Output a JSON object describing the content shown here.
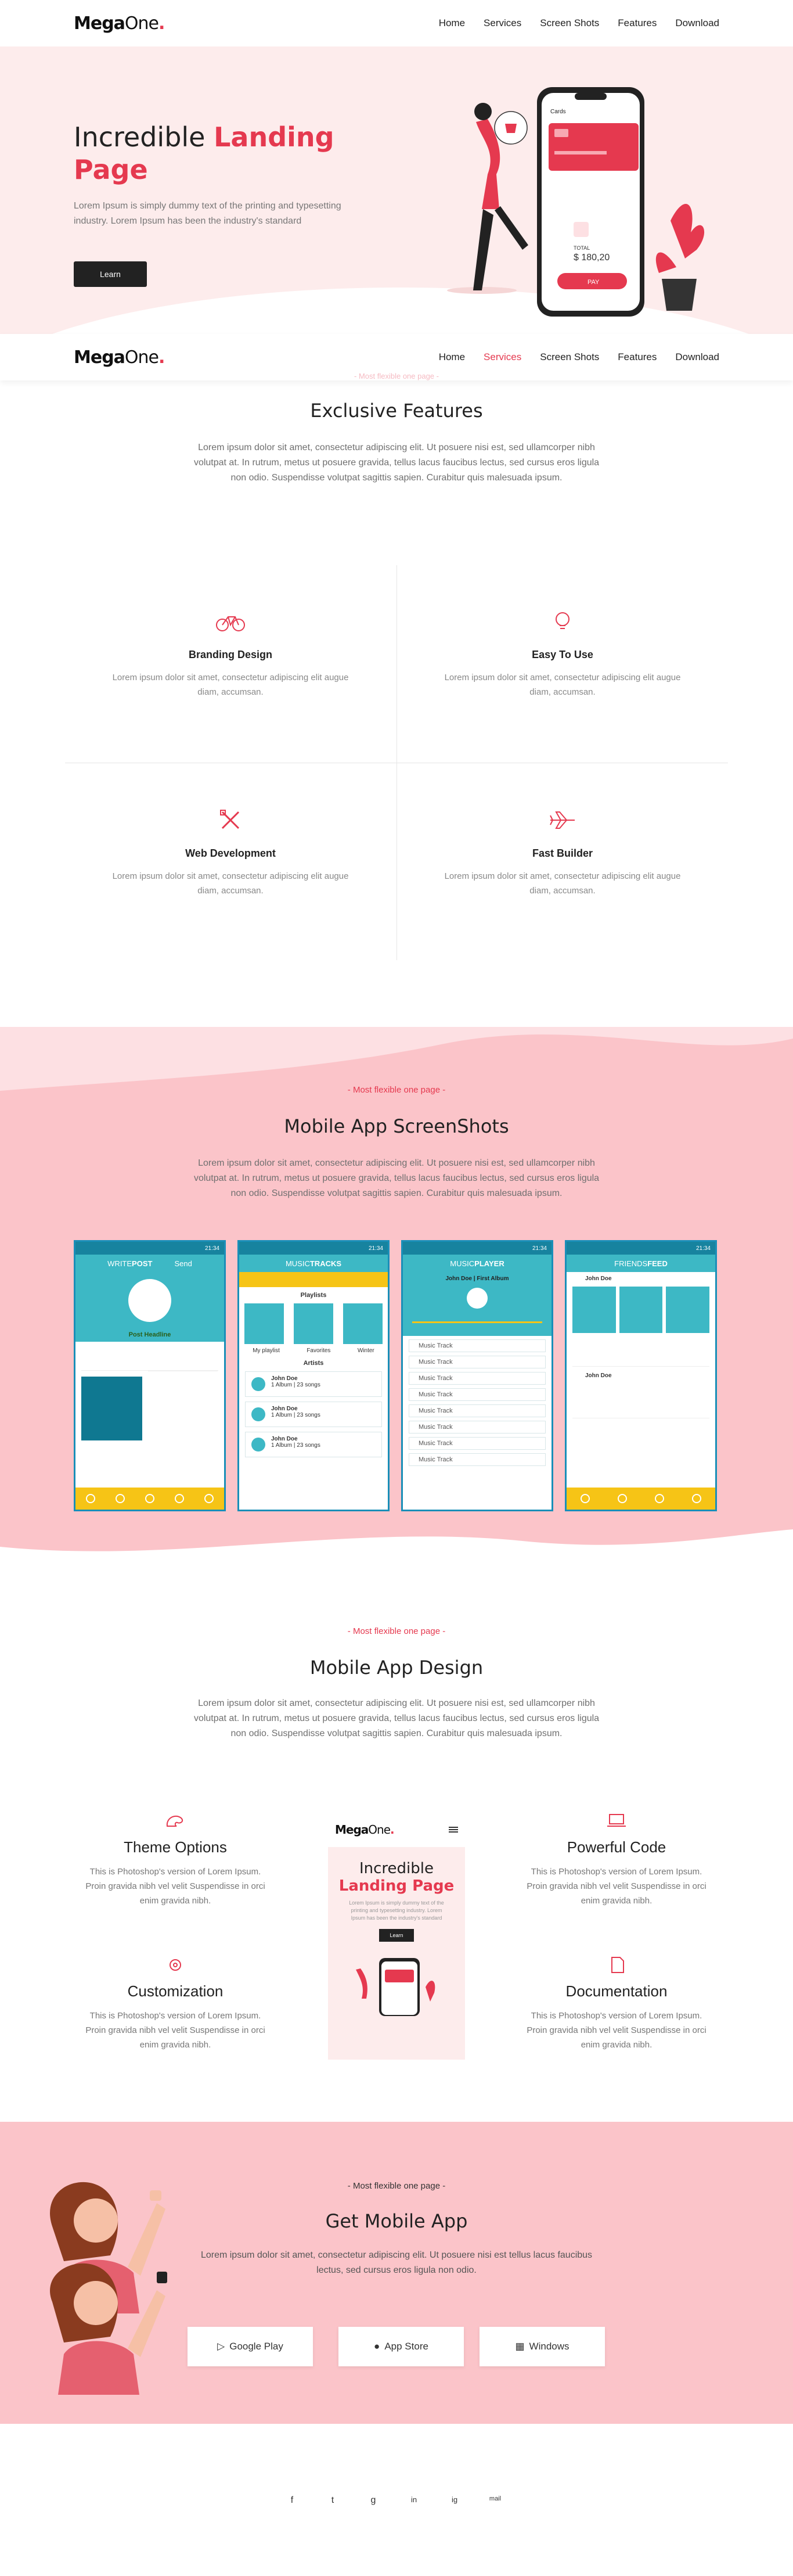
{
  "brand": {
    "name_bold": "Mega",
    "name_light": "One",
    "dot": "."
  },
  "nav": {
    "items": [
      "Home",
      "Services",
      "Screen Shots",
      "Features",
      "Download"
    ]
  },
  "hero": {
    "title_line1": "Incredible ",
    "title_highlight": "Landing",
    "title_line2": "Page",
    "text": "Lorem Ipsum is simply dummy text of the printing and typesetting industry. Lorem Ipsum has been the industry's standard",
    "button": "Learn",
    "mockup": {
      "card_label": "Cards",
      "total_label": "TOTAL",
      "total_value": "$ 180,20",
      "pay_button": "PAY"
    }
  },
  "features": {
    "faded_subtitle": "- Most flexible one page -",
    "title": "Exclusive Features",
    "text": "Lorem ipsum dolor sit amet, consectetur adipiscing elit. Ut posuere nisi est, sed ullamcorper nibh volutpat at. In rutrum, metus ut posuere gravida, tellus lacus faucibus lectus, sed cursus eros ligula non odio. Suspendisse volutpat sagittis sapien. Curabitur quis malesuada ipsum.",
    "items": [
      {
        "title": "Branding Design",
        "desc": "Lorem ipsum dolor sit amet, consectetur adipiscing elit augue diam, accumsan."
      },
      {
        "title": "Easy To Use",
        "desc": "Lorem ipsum dolor sit amet, consectetur adipiscing elit augue diam, accumsan."
      },
      {
        "title": "Web Development",
        "desc": "Lorem ipsum dolor sit amet, consectetur adipiscing elit augue diam, accumsan."
      },
      {
        "title": "Fast Builder",
        "desc": "Lorem ipsum dolor sit amet, consectetur adipiscing elit augue diam, accumsan."
      }
    ]
  },
  "screens": {
    "subtitle": "- Most flexible one page -",
    "title": "Mobile App ScreenShots",
    "text": "Lorem ipsum dolor sit amet, consectetur adipiscing elit. Ut posuere nisi est, sed ullamcorper nibh volutpat at. In rutrum, metus ut posuere gravida, tellus lacus faucibus lectus, sed cursus eros ligula non odio. Suspendisse volutpat sagittis sapien. Curabitur quis malesuada ipsum.",
    "phones": [
      {
        "head_a": "WRITE ",
        "head_b": "POST",
        "extra": "Send",
        "status": "21:34"
      },
      {
        "head_a": "MUSIC ",
        "head_b": "TRACKS",
        "extra": "",
        "status": "21:34"
      },
      {
        "head_a": "MUSIC ",
        "head_b": "PLAYER",
        "extra": "",
        "status": "21:34"
      },
      {
        "head_a": "FRIENDS ",
        "head_b": "FEED",
        "extra": "",
        "status": "21:34"
      }
    ],
    "post_headline": "Post Headline",
    "playlists_label": "Playlists",
    "playlist_tabs": [
      "My playlist",
      "Favorites",
      "Winter"
    ],
    "artists_label": "Artists",
    "artist_name": "John Doe",
    "artist_meta": "1 Album | 23 songs",
    "player_title": "John Doe | First Album",
    "track_label": "Music Track",
    "feed_user": "John Doe"
  },
  "design": {
    "subtitle": "- Most flexible one page -",
    "title": "Mobile App Design",
    "text": "Lorem ipsum dolor sit amet, consectetur adipiscing elit. Ut posuere nisi est, sed ullamcorper nibh volutpat at. In rutrum, metus ut posuere gravida, tellus lacus faucibus lectus, sed cursus eros ligula non odio. Suspendisse volutpat sagittis sapien. Curabitur quis malesuada ipsum.",
    "items": [
      {
        "title": "Theme Options",
        "desc": "This is Photoshop's version of Lorem Ipsum. Proin gravida nibh vel velit Suspendisse in orci enim gravida nibh."
      },
      {
        "title": "Powerful Code",
        "desc": "This is Photoshop's version of Lorem Ipsum. Proin gravida nibh vel velit Suspendisse in orci enim gravida nibh."
      },
      {
        "title": "Customization",
        "desc": "This is Photoshop's version of Lorem Ipsum. Proin gravida nibh vel velit Suspendisse in orci enim gravida nibh."
      },
      {
        "title": "Documentation",
        "desc": "This is Photoshop's version of Lorem Ipsum. Proin gravida nibh vel velit Suspendisse in orci enim gravida nibh."
      }
    ],
    "mini": {
      "title_a": "Incredible",
      "title_b": "Landing Page",
      "text": "Lorem Ipsum is simply dummy text of the printing and typesetting industry. Lorem Ipsum has been the industry's standard",
      "button": "Learn"
    }
  },
  "download": {
    "subtitle": "- Most flexible one page -",
    "title": "Get Mobile App",
    "text": "Lorem ipsum dolor sit amet, consectetur adipiscing elit. Ut posuere nisi est tellus lacus faucibus lectus, sed cursus eros ligula non odio.",
    "buttons": [
      "Google Play",
      "App Store",
      "Windows"
    ]
  },
  "footer": {
    "social": [
      "f",
      "t",
      "g",
      "in",
      "ig",
      "mail"
    ]
  },
  "colors": {
    "accent": "#e5394f",
    "hero_bg": "#fdecec",
    "pink_band": "#fbc4c9",
    "app_teal": "#3db8c5",
    "app_yellow": "#f6c416"
  }
}
